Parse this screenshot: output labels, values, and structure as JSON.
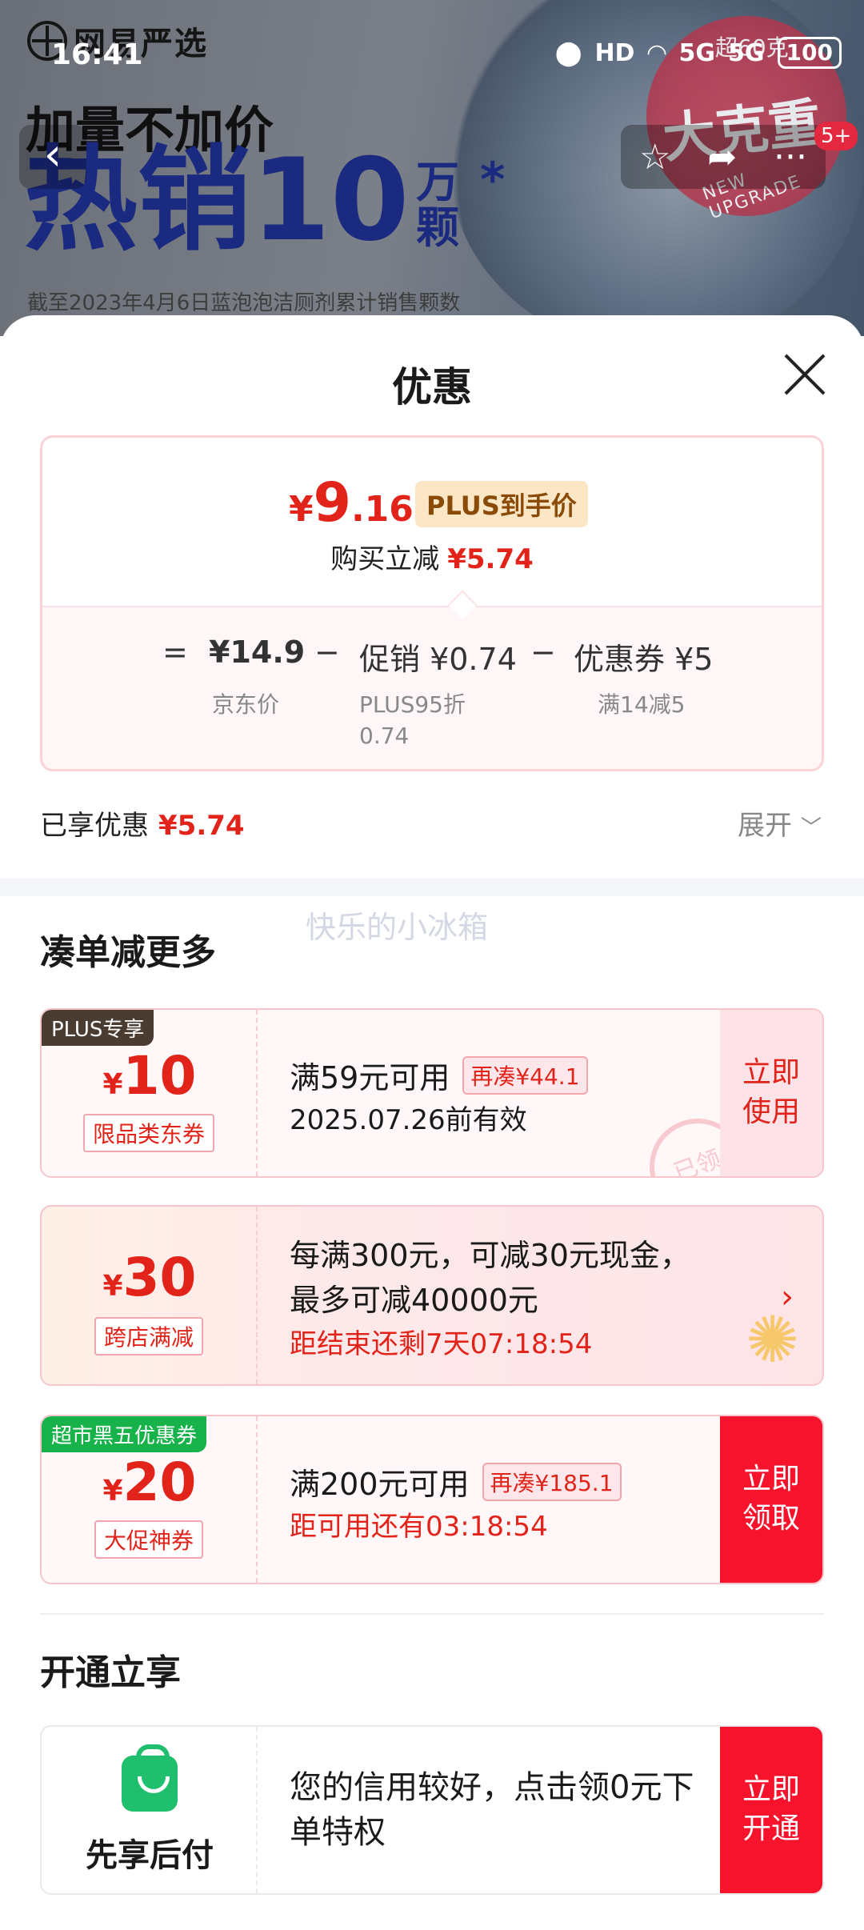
{
  "backdrop": {
    "brand": "网易严选",
    "headline": "加量不加价",
    "hero_main": "热销10",
    "hero_unit": "万颗",
    "hero_star": "*",
    "footnote": "截至2023年4月6日蓝泡泡洁厕剂累计销售颗数",
    "badge_small": "超60克",
    "badge_big": "大克重",
    "badge_en": "NEW UPGRADE"
  },
  "status": {
    "time": "16:41",
    "hd": "HD",
    "net1": "5G",
    "net2": "5G",
    "battery": "100"
  },
  "nav": {
    "back": "‹",
    "favorite": "☆",
    "share": "➦",
    "more": "···",
    "badge": "5+"
  },
  "sheet": {
    "title": "优惠",
    "price": {
      "yen": "¥",
      "int": "9",
      "dec": ".16",
      "plus_tag": "PLUS到手价",
      "sub_label": "购买立减",
      "sub_value": "¥5.74"
    },
    "formula": {
      "eq": "=",
      "jd_price": "¥14.9",
      "minus1": "−",
      "promo": "促销 ¥0.74",
      "minus2": "−",
      "coupon": "优惠券 ¥5",
      "jd_label": "京东价",
      "promo_label": "PLUS95折 0.74",
      "coupon_label": "满14减5"
    },
    "enjoyed_label": "已享优惠",
    "enjoyed_value": "¥5.74",
    "expand_label": "展开",
    "watermark": "快乐的小冰箱",
    "section1": "凑单减更多",
    "coupons": [
      {
        "tag": "PLUS专享",
        "yen": "¥",
        "value": "10",
        "type": "限品类东券",
        "line1": "满59元可用",
        "chip": "再凑¥44.1",
        "line2": "2025.07.26前有效",
        "cta": "立即使用",
        "stamp": "已领"
      },
      {
        "yen": "¥",
        "value": "30",
        "type": "跨店满减",
        "line1": "每满300元，可减30元现金，",
        "line1b": "最多可减40000元",
        "line2": "距结束还剩7天07:18:54",
        "chevron": "›"
      },
      {
        "tag": "超市黑五优惠券",
        "yen": "¥",
        "value": "20",
        "type": "大促神券",
        "line1": "满200元可用",
        "chip": "再凑¥185.1",
        "line2": "距可用还有03:18:54",
        "cta": "立即领取"
      }
    ],
    "section2": "开通立享",
    "credit": {
      "label": "先享后付",
      "text": "您的信用较好，点击领0元下单特权",
      "cta": "立即开通"
    }
  }
}
